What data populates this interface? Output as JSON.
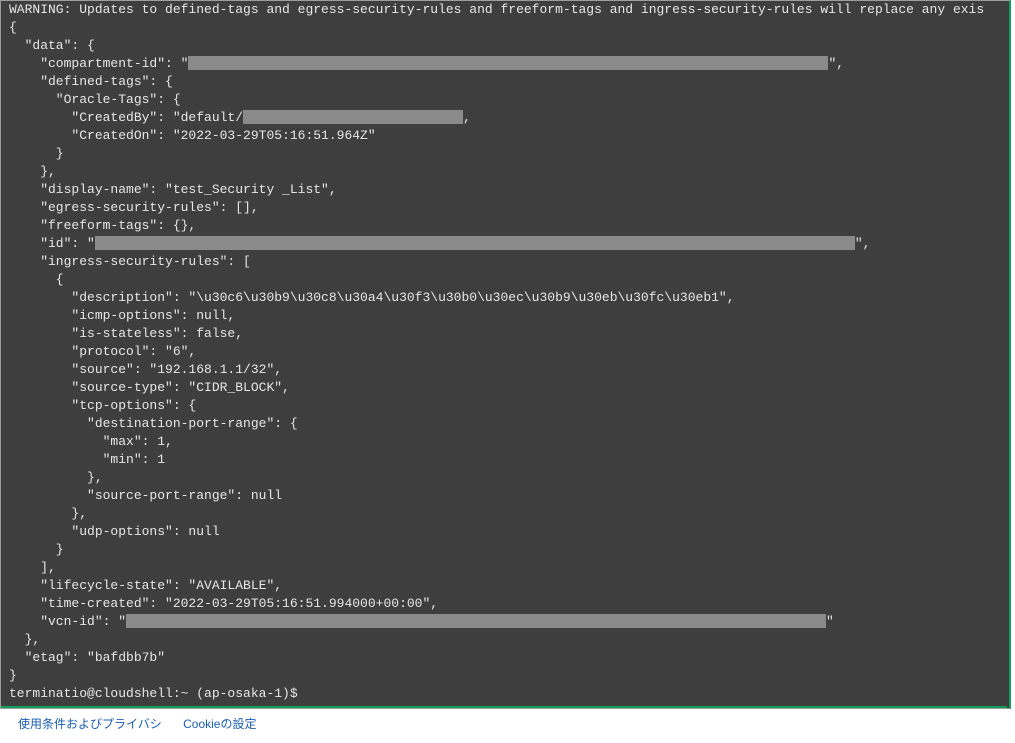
{
  "warning": "WARNING: Updates to defined-tags and egress-security-rules and freeform-tags and ingress-security-rules will replace any exis",
  "json_lines": [
    {
      "indent": 0,
      "text": "{"
    },
    {
      "indent": 1,
      "text": "\"data\": {"
    },
    {
      "indent": 2,
      "text": "\"compartment-id\": \"",
      "redact_w": 640,
      "after": "\","
    },
    {
      "indent": 2,
      "text": "\"defined-tags\": {"
    },
    {
      "indent": 3,
      "text": "\"Oracle-Tags\": {"
    },
    {
      "indent": 4,
      "text": "\"CreatedBy\": \"default/",
      "redact_w": 220,
      "after": ","
    },
    {
      "indent": 4,
      "text": "\"CreatedOn\": \"2022-03-29T05:16:51.964Z\""
    },
    {
      "indent": 3,
      "text": "}"
    },
    {
      "indent": 2,
      "text": "},"
    },
    {
      "indent": 2,
      "text": "\"display-name\": \"test_Security _List\","
    },
    {
      "indent": 2,
      "text": "\"egress-security-rules\": [],"
    },
    {
      "indent": 2,
      "text": "\"freeform-tags\": {},"
    },
    {
      "indent": 2,
      "text": "\"id\": \"",
      "redact_w": 760,
      "after": "\","
    },
    {
      "indent": 2,
      "text": "\"ingress-security-rules\": ["
    },
    {
      "indent": 3,
      "text": "{"
    },
    {
      "indent": 4,
      "text": "\"description\": \"\\u30c6\\u30b9\\u30c8\\u30a4\\u30f3\\u30b0\\u30ec\\u30b9\\u30eb\\u30fc\\u30eb1\","
    },
    {
      "indent": 4,
      "text": "\"icmp-options\": null,"
    },
    {
      "indent": 4,
      "text": "\"is-stateless\": false,"
    },
    {
      "indent": 4,
      "text": "\"protocol\": \"6\","
    },
    {
      "indent": 4,
      "text": "\"source\": \"192.168.1.1/32\","
    },
    {
      "indent": 4,
      "text": "\"source-type\": \"CIDR_BLOCK\","
    },
    {
      "indent": 4,
      "text": "\"tcp-options\": {"
    },
    {
      "indent": 5,
      "text": "\"destination-port-range\": {"
    },
    {
      "indent": 6,
      "text": "\"max\": 1,"
    },
    {
      "indent": 6,
      "text": "\"min\": 1"
    },
    {
      "indent": 5,
      "text": "},"
    },
    {
      "indent": 5,
      "text": "\"source-port-range\": null"
    },
    {
      "indent": 4,
      "text": "},"
    },
    {
      "indent": 4,
      "text": "\"udp-options\": null"
    },
    {
      "indent": 3,
      "text": "}"
    },
    {
      "indent": 2,
      "text": "],"
    },
    {
      "indent": 2,
      "text": "\"lifecycle-state\": \"AVAILABLE\","
    },
    {
      "indent": 2,
      "text": "\"time-created\": \"2022-03-29T05:16:51.994000+00:00\","
    },
    {
      "indent": 2,
      "text": "\"vcn-id\": \"",
      "redact_w": 700,
      "after": "\""
    },
    {
      "indent": 1,
      "text": "},"
    },
    {
      "indent": 1,
      "text": "\"etag\": \"bafdbb7b\""
    },
    {
      "indent": 0,
      "text": "}"
    }
  ],
  "prompt": "terminatio@cloudshell:~ (ap-osaka-1)$",
  "footer": {
    "terms": "使用条件およびプライバシ",
    "cookie": "Cookieの設定"
  }
}
